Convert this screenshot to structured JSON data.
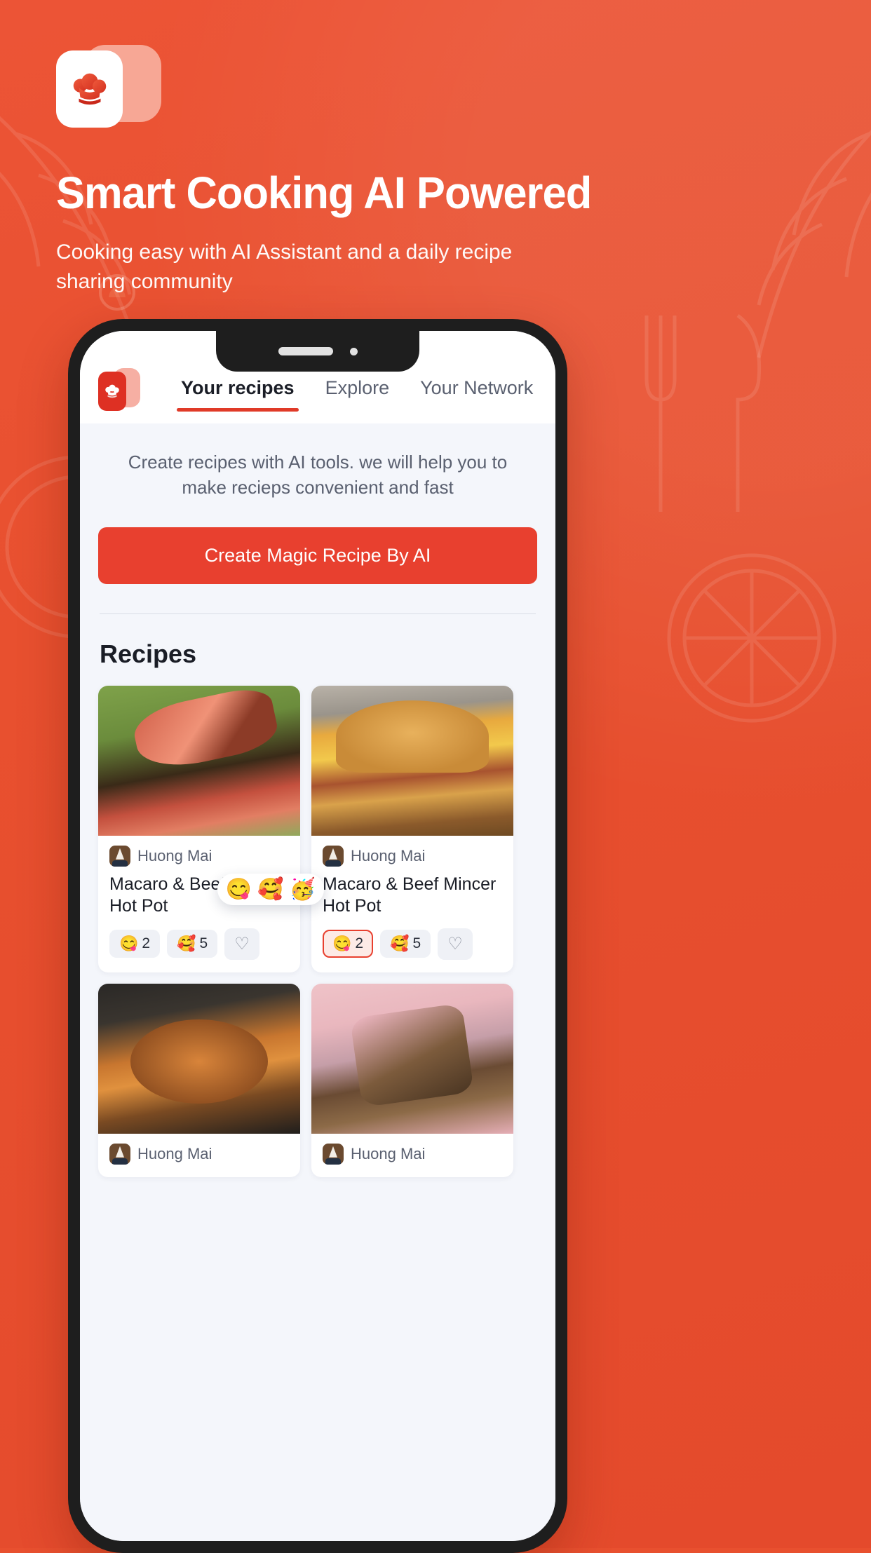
{
  "hero": {
    "logo_icon": "chef-hat-card-logo",
    "headline": "Smart Cooking AI Powered",
    "subhead": "Cooking easy with AI Assistant and a daily recipe sharing community",
    "background_color": "#E8502F",
    "headline_color": "#FFFFFF"
  },
  "phone": {
    "notch": {
      "speaker_icon": "speaker-bar",
      "camera_icon": "front-camera-dot"
    },
    "app": {
      "logo_icon": "chef-hat-card-logo-small",
      "tabs": [
        {
          "label": "Your recipes",
          "active": true
        },
        {
          "label": "Explore",
          "active": false
        },
        {
          "label": "Your Network",
          "active": false
        }
      ],
      "active_tab_color": "#E03A28",
      "ai_panel": {
        "description": "Create recipes with AI tools. we will help you to make recieps convenient and fast",
        "cta_label": "Create Magic Recipe By AI",
        "cta_color": "#E8402F"
      },
      "section_title": "Recipes",
      "reaction_popup": {
        "emojis": [
          "😋",
          "🥰",
          "🥳"
        ]
      },
      "recipes": [
        {
          "image": "grilled-steak-photo",
          "author": "Huong Mai",
          "title": "Macaro & Beef Mincer Hot Pot",
          "reactions": [
            {
              "emoji": "😋",
              "count": "2",
              "selected": false
            },
            {
              "emoji": "🥰",
              "count": "5",
              "selected": false
            }
          ],
          "like_icon": "heart-outline-icon",
          "has_popup": true
        },
        {
          "image": "bacon-cheese-burger-photo",
          "author": "Huong Mai",
          "title": "Macaro & Beef Mincer Hot Pot",
          "reactions": [
            {
              "emoji": "😋",
              "count": "2",
              "selected": true
            },
            {
              "emoji": "🥰",
              "count": "5",
              "selected": false
            }
          ],
          "like_icon": "heart-outline-icon",
          "has_popup": false
        },
        {
          "image": "spaghetti-bolognese-photo",
          "author": "Huong Mai",
          "title": "",
          "reactions": [],
          "like_icon": "heart-outline-icon",
          "has_popup": false
        },
        {
          "image": "berry-dessert-photo",
          "author": "Huong Mai",
          "title": "",
          "reactions": [],
          "like_icon": "heart-outline-icon",
          "has_popup": false
        }
      ]
    }
  }
}
